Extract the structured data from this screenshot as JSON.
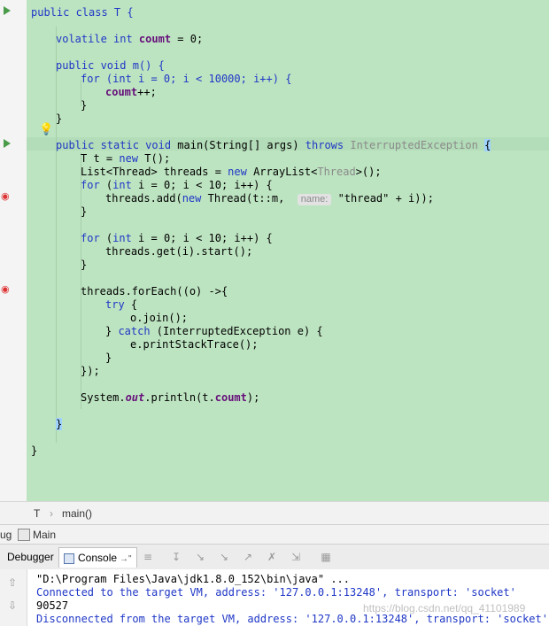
{
  "editor": {
    "lines": {
      "l1": [
        "public class T {"
      ],
      "l3": [
        "volatile int ",
        "coumt",
        " = 0;"
      ],
      "l5": [
        "public void m() {"
      ],
      "l6": [
        "for (int i = 0; i < 10000; i++) {"
      ],
      "l7": [
        "coumt",
        "++;"
      ],
      "l8": [
        "}"
      ],
      "l9": [
        "}"
      ],
      "l11": [
        "public static void",
        " main(String[] args) ",
        "throws",
        " InterruptedException ",
        "{"
      ],
      "l12": [
        "T t = ",
        "new",
        " T();"
      ],
      "l13": [
        "List<Thread> threads = ",
        "new",
        " ArrayList<",
        "Thread",
        ">();"
      ],
      "l14": [
        "for",
        " (",
        "int",
        " i = 0; i < 10; i++) {"
      ],
      "l15": [
        "threads.add(",
        "new",
        " Thread(t::m,  ",
        "name:",
        " \"thread\" + i));"
      ],
      "l16": [
        "}"
      ],
      "l18": [
        "for",
        " (",
        "int",
        " i = 0; i < 10; i++) {"
      ],
      "l19": [
        "threads.get(i).start();"
      ],
      "l20": [
        "}"
      ],
      "l22": [
        "threads.forEach((o) ->{"
      ],
      "l23": [
        "try",
        " {"
      ],
      "l24": [
        "o.join();"
      ],
      "l25": [
        "} ",
        "catch",
        " (InterruptedException e) {"
      ],
      "l26": [
        "e.printStackTrace();"
      ],
      "l27": [
        "}"
      ],
      "l28": [
        "});"
      ],
      "l30": [
        "System.",
        "out",
        ".println(t.",
        "coumt",
        ");"
      ],
      "l32": [
        "}"
      ],
      "l34": [
        "}"
      ]
    }
  },
  "breadcrumb": {
    "class": "T",
    "separator": "›",
    "method": "main()"
  },
  "debug": {
    "title_prefix": "ug",
    "config_name": "Main"
  },
  "tabs": {
    "debugger": "Debugger",
    "console": "Console",
    "console_suffix": "→\""
  },
  "toolbar_icons": [
    "restore-layout-icon",
    "scroll-to-end-icon",
    "step-over-icon",
    "step-into-icon",
    "force-step-into-icon",
    "step-out-icon",
    "drop-frame-icon",
    "run-to-cursor-icon",
    "evaluate-icon"
  ],
  "console": {
    "lines": [
      "\"D:\\Program Files\\Java\\jdk1.8.0_152\\bin\\java\" ...",
      "Connected to the target VM, address: '127.0.0.1:13248', transport: 'socket'",
      "90527",
      "Disconnected from the target VM, address: '127.0.0.1:13248', transport: 'socket'"
    ],
    "watermark": "https://blog.csdn.net/qq_41101989"
  },
  "colors": {
    "editor_bg": "#bde4c1",
    "keyword": "#1f37c6",
    "field": "#660e7a"
  }
}
